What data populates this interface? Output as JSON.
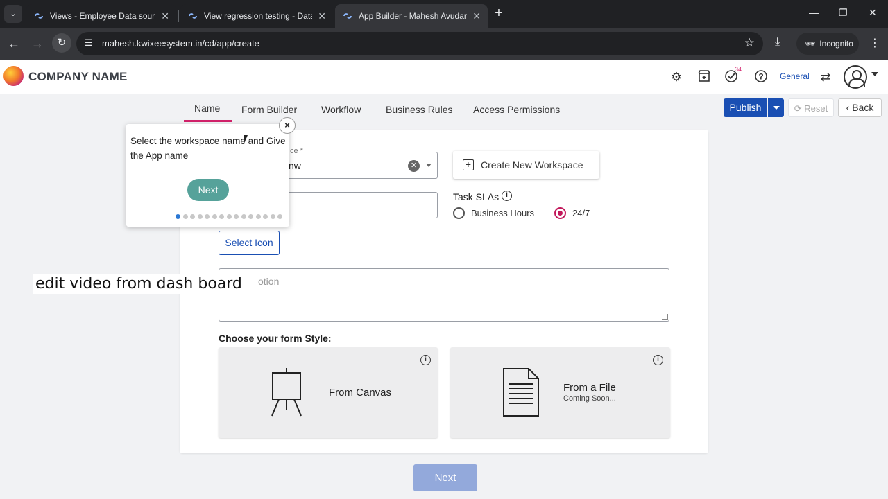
{
  "browser": {
    "tabs": [
      {
        "title": "Views - Employee Data source",
        "active": false
      },
      {
        "title": "View regression testing - Data",
        "active": false
      },
      {
        "title": "App Builder - Mahesh Avudam",
        "active": true
      }
    ],
    "url": "mahesh.kwixeesystem.in/cd/app/create",
    "incognito_label": "Incognito",
    "accent": "#8ab4f8"
  },
  "header": {
    "brand": "COMPANY NAME",
    "badge_count": "34",
    "context_label": "General"
  },
  "subnav": {
    "items": [
      "Name",
      "Form Builder",
      "Workflow",
      "Business Rules",
      "Access Permissions"
    ],
    "active_index": 0
  },
  "actions": {
    "publish": "Publish",
    "reset": "Reset",
    "back": "Back"
  },
  "form": {
    "workspace_label": "ce *",
    "workspace_value": "nw",
    "create_workspace": "Create New Workspace",
    "sla_title": "Task SLAs",
    "sla_options": [
      "Business Hours",
      "24/7"
    ],
    "sla_selected": "24/7",
    "select_icon": "Select Icon",
    "description_placeholder": "otion",
    "style_title": "Choose your form Style:",
    "styles": [
      {
        "label": "From Canvas",
        "sub": ""
      },
      {
        "label": "From a File",
        "sub": "Coming Soon..."
      }
    ],
    "next": "Next"
  },
  "tour": {
    "text": "Select the workspace name and Give the App name",
    "next": "Next",
    "close": "×",
    "steps": 15,
    "current": 0
  },
  "caption": "edit video from dash board",
  "colors": {
    "primary": "#1a4fb3",
    "accent": "#d2226b",
    "tour_next": "#56a29a"
  }
}
